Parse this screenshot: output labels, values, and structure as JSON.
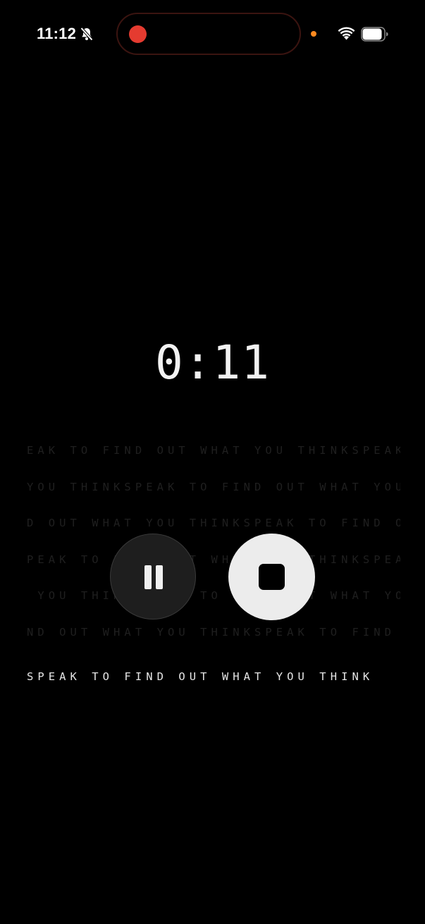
{
  "status_bar": {
    "time": "11:12",
    "icons": [
      "bell-slash-icon",
      "wifi-icon",
      "battery-icon"
    ],
    "recording_indicator_color": "#e53b30",
    "privacy_indicator_color": "#ff8a1f"
  },
  "recorder": {
    "elapsed": "0:11",
    "marquee_lines": [
      "EAK TO FIND OUT WHAT YOU THINKSPEAK TO FIND OUT WHAT YOU THINK",
      "YOU THINKSPEAK TO FIND OUT WHAT YOU THINKSPEAK TO FIND OUT WHAT",
      "D OUT WHAT YOU THINKSPEAK TO FIND OUT WHAT YOU THINKSPEAK TO FIN",
      "PEAK TO FIND OUT WHAT YOU THINKSPEAK TO FIND OUT WHAT YOU THINKS",
      " YOU THINKSPEAK TO FIND OUT WHAT YOU THINKSPEAK TO FIND OUT WHAT",
      "ND OUT WHAT YOU THINKSPEAK TO FIND OUT WHAT YOU THINKSPEAK TO FI"
    ],
    "tagline": "SPEAK TO FIND OUT WHAT YOU THINK",
    "controls": {
      "pause_icon": "pause-icon",
      "stop_icon": "stop-icon"
    }
  },
  "colors": {
    "background": "#000000",
    "text": "#f2f2f2",
    "pause_button": "#1e1e1e",
    "stop_button": "#ececec"
  }
}
